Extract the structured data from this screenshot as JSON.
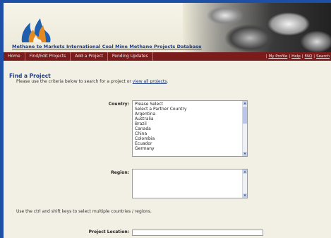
{
  "header": {
    "title": "Methane to Markets International Coal Mine Methane Projects Database",
    "brand_colors": {
      "flame_blue": "#1f5fb0",
      "flame_orange": "#e58a1f",
      "nav_bg": "#7b1c1c",
      "link": "#1d3b86"
    }
  },
  "nav": {
    "items": [
      {
        "label": "Home"
      },
      {
        "label": "Find/Edit Projects"
      },
      {
        "label": "Add a Project"
      },
      {
        "label": "Pending Updates"
      }
    ],
    "right_links": [
      {
        "label": "My Profile"
      },
      {
        "label": "Help"
      },
      {
        "label": "FAQ"
      },
      {
        "label": "Search"
      }
    ],
    "separator": "|"
  },
  "main": {
    "title": "Find a Project",
    "instructions_prefix": "Please use the criteria below to search for a project or ",
    "instructions_link": "view all projects",
    "instructions_suffix": ".",
    "country": {
      "label": "Country:",
      "options": [
        "Please Select",
        "Select a Partner Country",
        "Argentina",
        "Australia",
        "Brazil",
        "Canada",
        "China",
        "Colombia",
        "Ecuador",
        "Germany"
      ]
    },
    "region": {
      "label": "Region:"
    },
    "hint": "Use the ctrl and shift keys to select multiple countries / regions.",
    "project_location": {
      "label": "Project Location:",
      "value": ""
    }
  }
}
